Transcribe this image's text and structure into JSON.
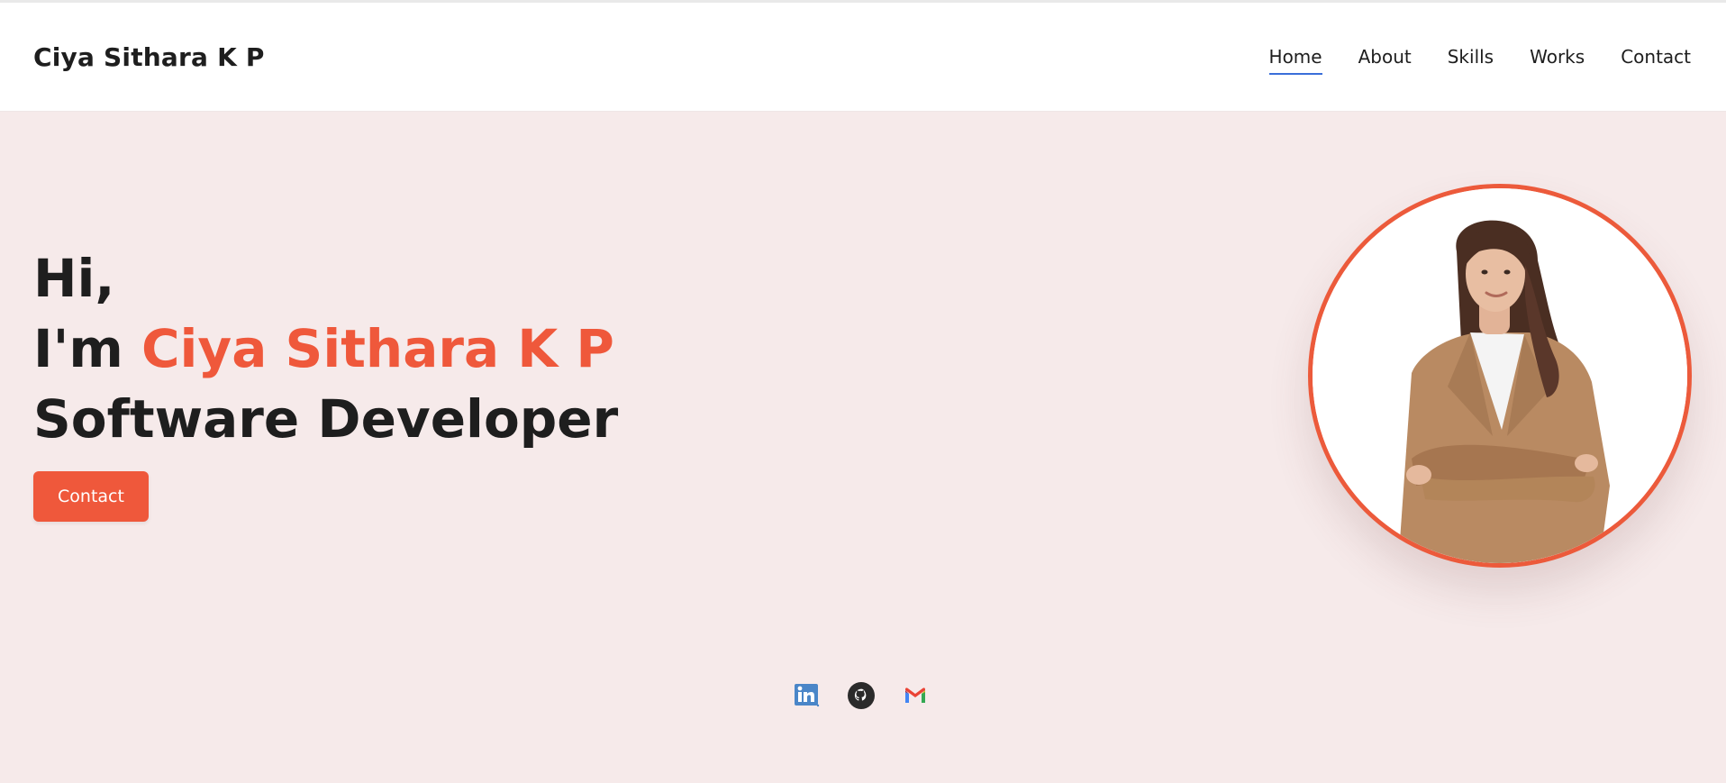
{
  "header": {
    "brand": "Ciya Sithara K P",
    "nav": [
      {
        "label": "Home",
        "active": true
      },
      {
        "label": "About"
      },
      {
        "label": "Skills"
      },
      {
        "label": "Works"
      },
      {
        "label": "Contact"
      }
    ],
    "active_underline_color": "#3b6fd9"
  },
  "hero": {
    "greeting": "Hi,",
    "intro": "I'm ",
    "name": "Ciya Sithara K P",
    "role": "Software Developer",
    "contact_button": "Contact",
    "accent_color": "#ef583b",
    "background_color": "#f6eaea",
    "profile_photo": "profile-photo"
  },
  "socials": [
    {
      "name": "linkedin-icon"
    },
    {
      "name": "github-icon"
    },
    {
      "name": "gmail-icon"
    }
  ]
}
